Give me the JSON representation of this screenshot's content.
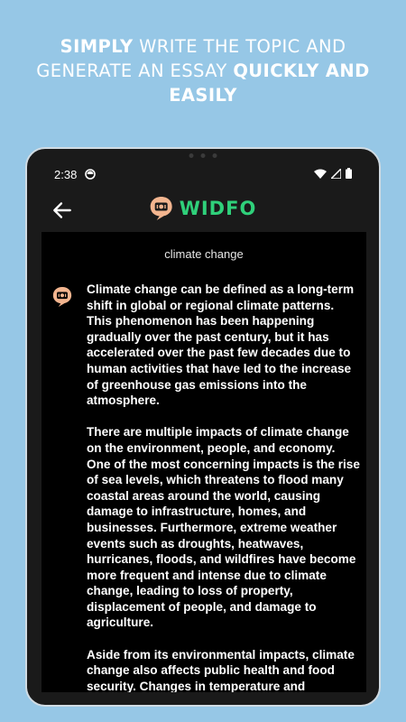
{
  "promo": {
    "line1_bold": "SIMPLY",
    "line1_rest": " WRITE THE TOPIC AND",
    "line2_rest": "GENERATE AN ESSAY ",
    "line2_bold": "QUICKLY AND",
    "line3_bold": "EASILY"
  },
  "status_bar": {
    "time": "2:38",
    "icons": [
      "notification-icon",
      "wifi-icon",
      "signal-icon",
      "battery-icon"
    ]
  },
  "app_bar": {
    "back_icon": "arrow-left-icon",
    "brand_name": "WIDFO",
    "brand_color": "#2fd07a",
    "logo_color": "#f3b58f"
  },
  "chat": {
    "topic": "climate change",
    "paragraphs": [
      "Climate change can be defined as a long-term shift in global or regional climate patterns. This phenomenon has been happening gradually over the past century, but it has accelerated over the past few decades due to human activities that have led to the increase of greenhouse gas emissions into the atmosphere.",
      "There are multiple impacts of climate change on the environment, people, and economy. One of the most concerning impacts is the rise of sea levels, which threatens to flood many coastal areas around the world, causing damage to infrastructure, homes, and businesses. Furthermore, extreme weather events such as droughts, heatwaves, hurricanes, floods, and wildfires have become more frequent and intense due to climate change, leading to loss of property, displacement of people, and damage to agriculture.",
      "Aside from its environmental impacts, climate change also affects public health and food security. Changes in temperature and"
    ]
  }
}
